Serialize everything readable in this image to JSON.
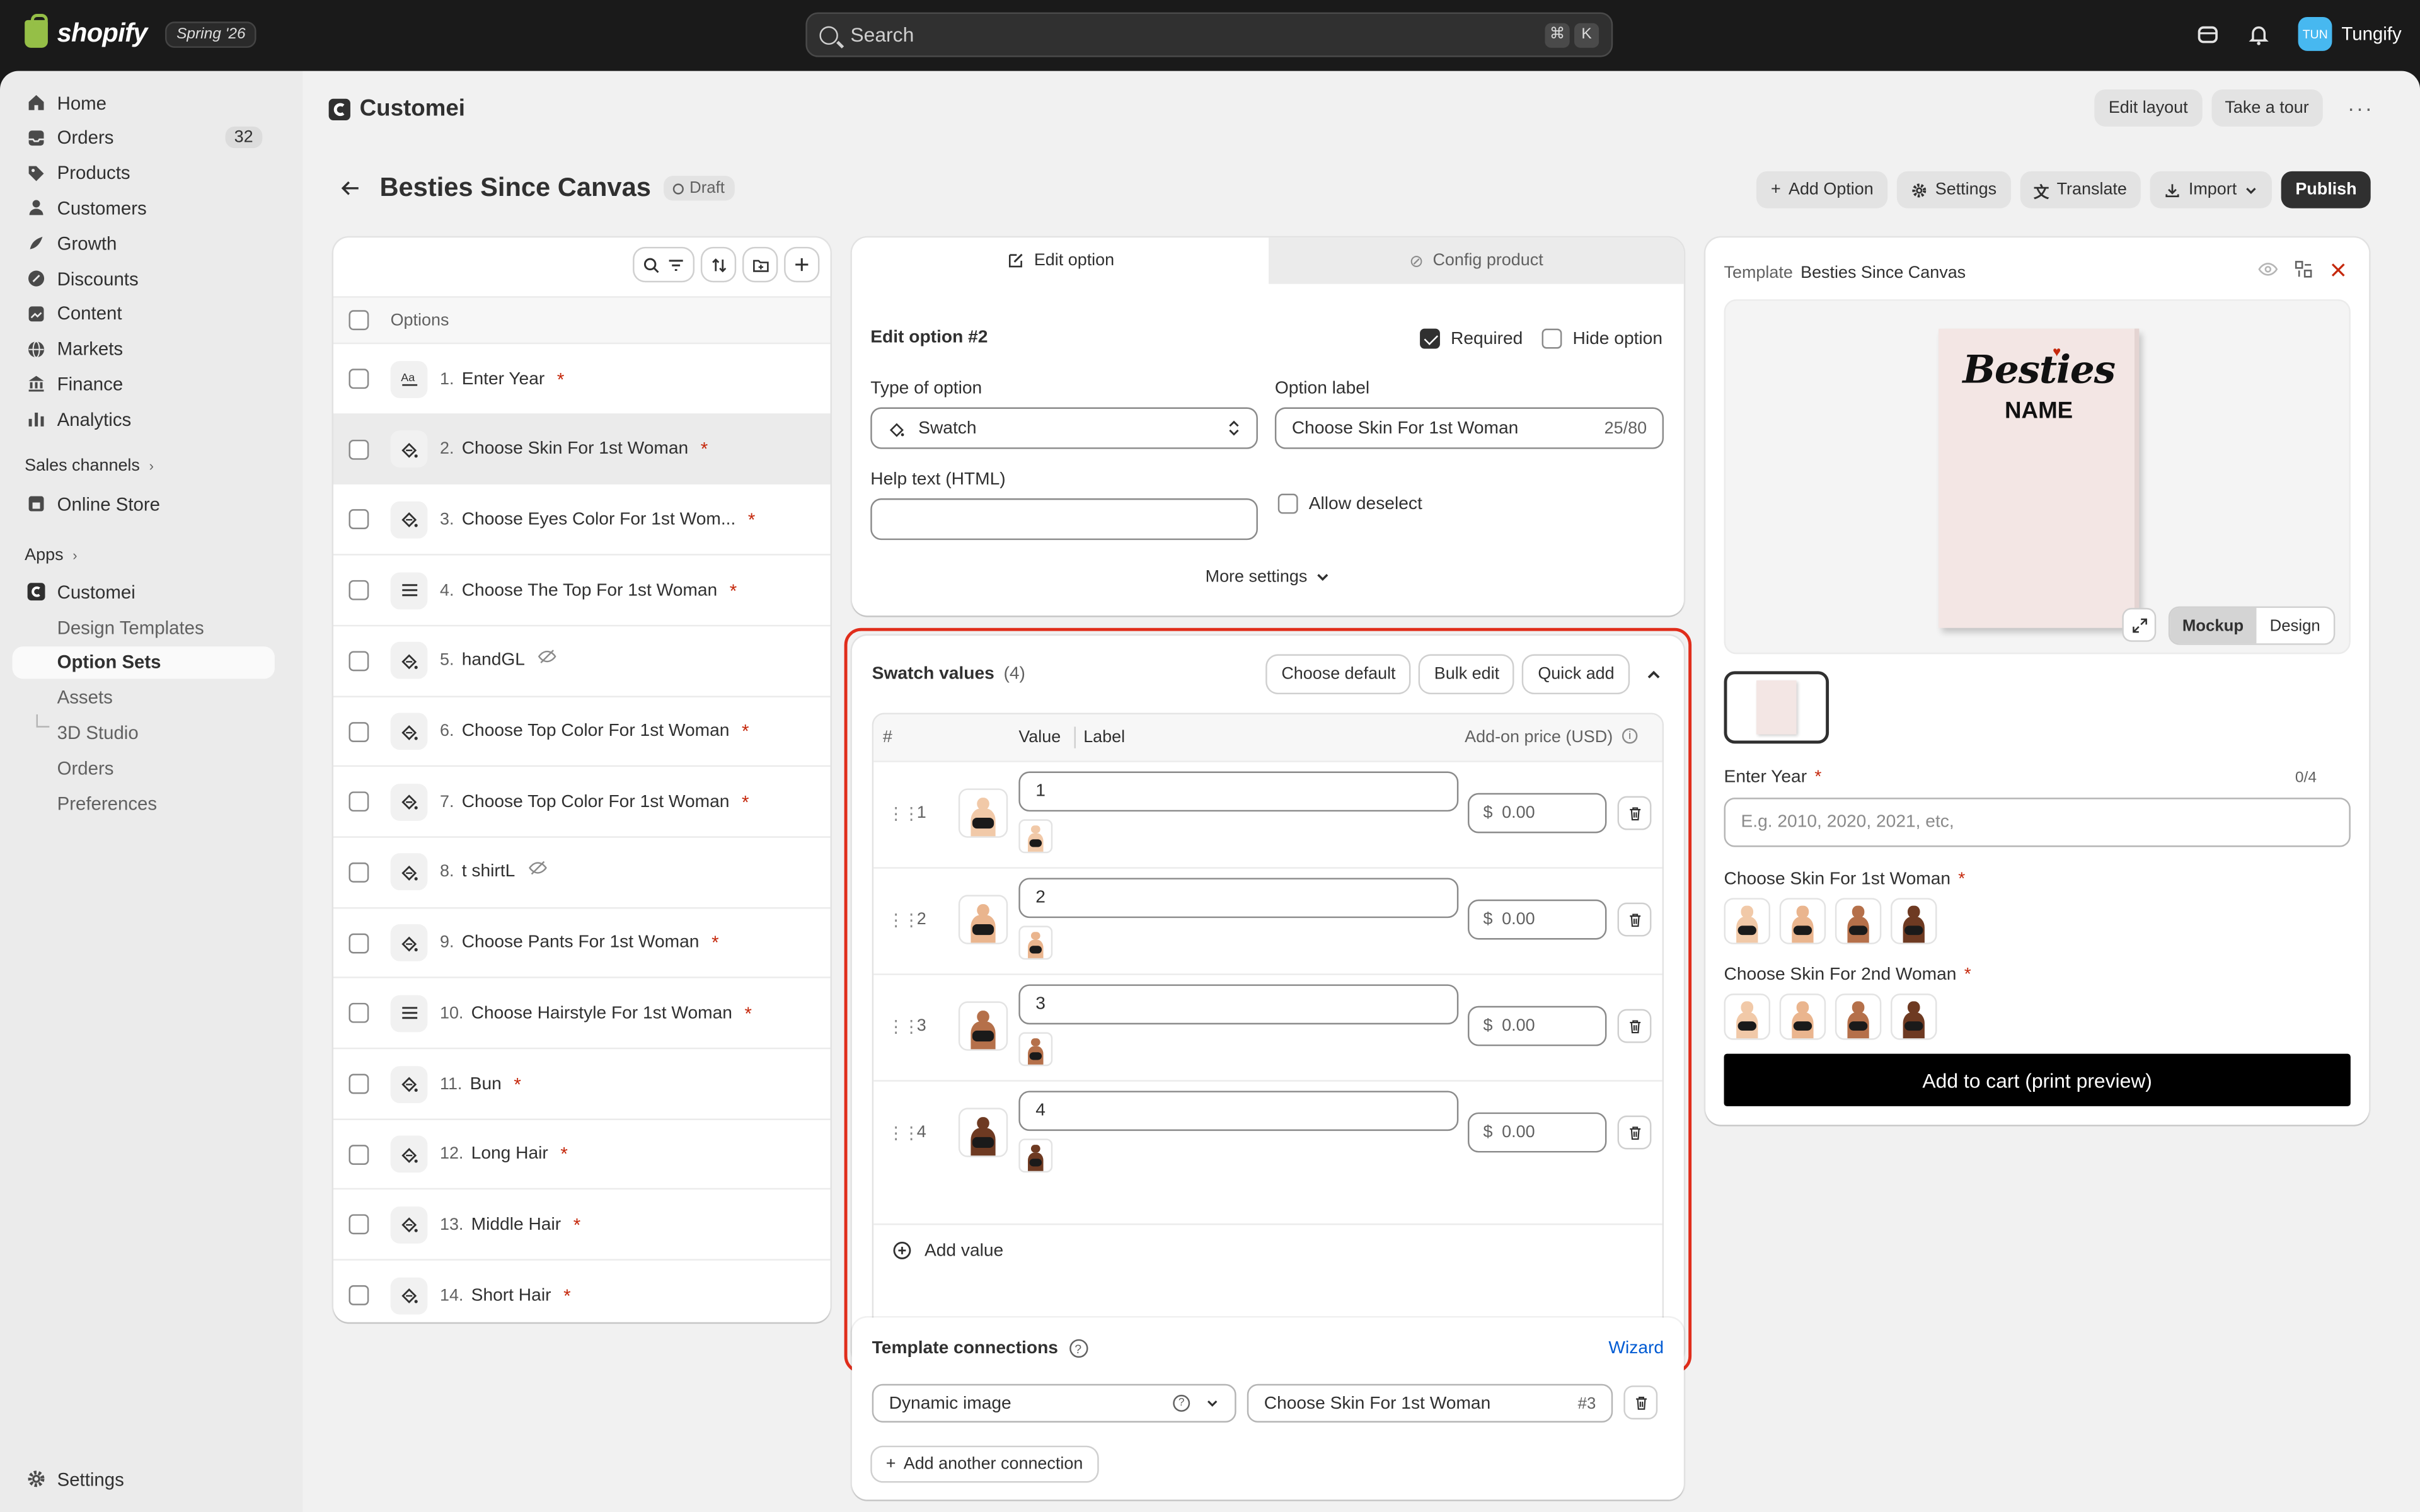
{
  "topbar": {
    "brand": "shopify",
    "edition": "Spring '26",
    "search_placeholder": "Search",
    "kbd1": "⌘",
    "kbd2": "K",
    "user_initials": "TUN",
    "user_name": "Tungify"
  },
  "sidebar": {
    "items": [
      {
        "label": "Home",
        "icon": "home-icon"
      },
      {
        "label": "Orders",
        "icon": "orders-icon",
        "badge": "32"
      },
      {
        "label": "Products",
        "icon": "tag-icon"
      },
      {
        "label": "Customers",
        "icon": "person-icon"
      },
      {
        "label": "Growth",
        "icon": "growth-icon"
      },
      {
        "label": "Discounts",
        "icon": "discount-icon"
      },
      {
        "label": "Content",
        "icon": "content-icon"
      },
      {
        "label": "Markets",
        "icon": "globe-icon"
      },
      {
        "label": "Finance",
        "icon": "bank-icon"
      },
      {
        "label": "Analytics",
        "icon": "chart-icon"
      }
    ],
    "sales_channels": "Sales channels",
    "online_store": "Online Store",
    "apps": "Apps",
    "app_name": "Customei",
    "app_items": [
      "Design Templates",
      "Option Sets",
      "Assets",
      "3D Studio",
      "Orders",
      "Preferences"
    ],
    "settings": "Settings"
  },
  "header": {
    "app_title": "Customei",
    "edit_layout": "Edit layout",
    "take_tour": "Take a tour",
    "page_title": "Besties Since Canvas",
    "status": "Draft",
    "add_option": "Add Option",
    "settings": "Settings",
    "translate": "Translate",
    "import": "Import",
    "publish": "Publish"
  },
  "options": {
    "header": "Options",
    "list": [
      {
        "num": "1.",
        "label": "Enter Year",
        "req": "*",
        "type": "text"
      },
      {
        "num": "2.",
        "label": "Choose Skin For 1st Woman",
        "req": "*",
        "type": "swatch"
      },
      {
        "num": "3.",
        "label": "Choose Eyes Color For 1st Wom...",
        "req": "*",
        "type": "swatch"
      },
      {
        "num": "4.",
        "label": "Choose The Top For 1st Woman",
        "req": "*",
        "type": "list"
      },
      {
        "num": "5.",
        "label": "handGL",
        "req": "",
        "type": "swatch",
        "hidden": true
      },
      {
        "num": "6.",
        "label": "Choose Top Color For 1st Woman",
        "req": "*",
        "type": "swatch"
      },
      {
        "num": "7.",
        "label": "Choose Top Color For 1st Woman",
        "req": "*",
        "type": "swatch"
      },
      {
        "num": "8.",
        "label": "t shirtL",
        "req": "",
        "type": "swatch",
        "hidden": true
      },
      {
        "num": "9.",
        "label": "Choose Pants For 1st Woman",
        "req": "*",
        "type": "swatch"
      },
      {
        "num": "10.",
        "label": "Choose Hairstyle For 1st Woman",
        "req": "*",
        "type": "list"
      },
      {
        "num": "11.",
        "label": "Bun",
        "req": "*",
        "type": "swatch"
      },
      {
        "num": "12.",
        "label": "Long Hair",
        "req": "*",
        "type": "swatch"
      },
      {
        "num": "13.",
        "label": "Middle Hair",
        "req": "*",
        "type": "swatch"
      },
      {
        "num": "14.",
        "label": "Short Hair",
        "req": "*",
        "type": "swatch"
      }
    ]
  },
  "editor": {
    "tab_edit": "Edit option",
    "tab_config": "Config product",
    "title": "Edit option #2",
    "required": "Required",
    "hide_option": "Hide option",
    "type_label": "Type of option",
    "type_value": "Swatch",
    "option_label": "Option label",
    "option_value": "Choose Skin For 1st Woman",
    "char_count": "25/80",
    "help_label": "Help text (HTML)",
    "allow_deselect": "Allow deselect",
    "more_settings": "More settings"
  },
  "swatch": {
    "title": "Swatch values",
    "count": "(4)",
    "choose_default": "Choose default",
    "bulk_edit": "Bulk edit",
    "quick_add": "Quick add",
    "col_hash": "#",
    "col_value": "Value",
    "col_label": "Label",
    "col_price": "Add-on price (USD)",
    "currency": "$",
    "values": [
      {
        "idx": "1",
        "value": "1",
        "price": "0.00",
        "skin": "#f1c9a8"
      },
      {
        "idx": "2",
        "value": "2",
        "price": "0.00",
        "skin": "#eab58e"
      },
      {
        "idx": "3",
        "value": "3",
        "price": "0.00",
        "skin": "#b5704a"
      },
      {
        "idx": "4",
        "value": "4",
        "price": "0.00",
        "skin": "#6e3a22"
      }
    ],
    "add_value": "Add value"
  },
  "connections": {
    "title": "Template connections",
    "wizard": "Wizard",
    "type": "Dynamic image",
    "target": "Choose Skin For 1st Woman",
    "target_id": "#3",
    "add": "Add another connection"
  },
  "preview": {
    "template_label": "Template",
    "template_name": "Besties Since Canvas",
    "mock_title": "Besties",
    "mock_sub": "NAME",
    "mockup": "Mockup",
    "design": "Design",
    "year_label": "Enter Year",
    "year_req": "*",
    "year_count": "0/4",
    "year_placeholder": "E.g. 2010, 2020, 2021, etc,",
    "skin1_label": "Choose Skin For 1st Woman",
    "skin2_label": "Choose Skin For 2nd Woman",
    "req": "*",
    "add_to_cart": "Add to cart (print preview)",
    "skins": [
      "#f1c9a8",
      "#eab58e",
      "#b5704a",
      "#6e3a22"
    ]
  },
  "colors": {
    "accent": "#303030",
    "required": "#c5280c",
    "highlight": "#e02d1b",
    "link": "#005bd3"
  }
}
